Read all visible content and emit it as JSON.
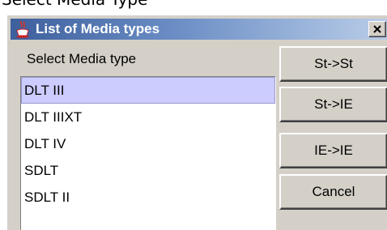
{
  "header_text": "Select Media Type",
  "window": {
    "title": "List of Media types",
    "close_label": "x"
  },
  "label": "Select Media type",
  "list": {
    "items": [
      "DLT III",
      "DLT IIIXT",
      "DLT IV",
      "SDLT",
      "SDLT II"
    ],
    "selected_index": 0
  },
  "buttons": {
    "st_st": "St->St",
    "st_ie": "St->IE",
    "ie_ie": "IE->IE",
    "cancel": "Cancel"
  },
  "colors": {
    "titlebar_start": "#3d5f9c",
    "titlebar_end": "#b9cde8",
    "selection": "#ccccff",
    "panel": "#d4d0c8"
  },
  "icons": {
    "title_icon": "java-coffee-cup-icon",
    "close_icon": "close-icon"
  }
}
